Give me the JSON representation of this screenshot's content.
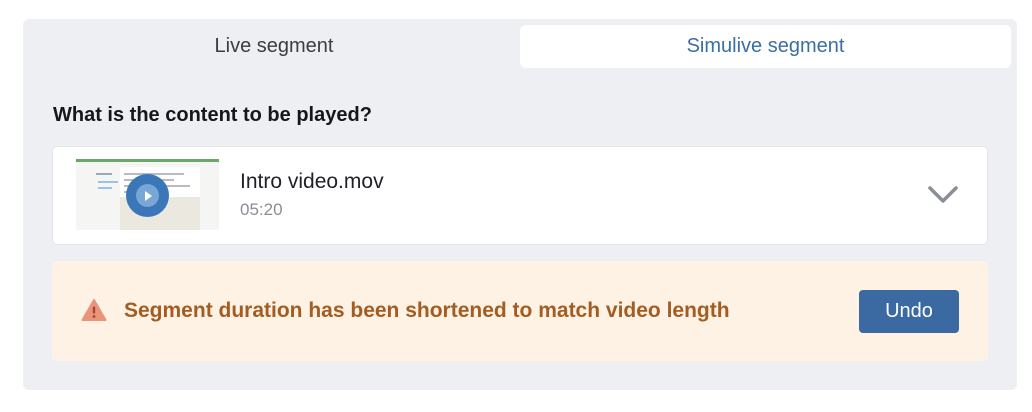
{
  "tabs": [
    {
      "label": "Live segment",
      "selected": false
    },
    {
      "label": "Simulive segment",
      "selected": true
    }
  ],
  "question": "What is the content to be played?",
  "content": {
    "file_name": "Intro video.mov",
    "duration": "05:20",
    "thumbnail_icon": "play-icon",
    "dropdown_icon": "chevron-down-icon"
  },
  "alert": {
    "icon": "warning-icon",
    "message": "Segment duration has been shortened to match video length",
    "action_label": "Undo"
  },
  "colors": {
    "accent": "#3b6ea5",
    "button": "#3a6aa1",
    "warning_text": "#a35d22",
    "warning_bg": "#fdf2e3",
    "warning_icon": "#e8937a"
  }
}
